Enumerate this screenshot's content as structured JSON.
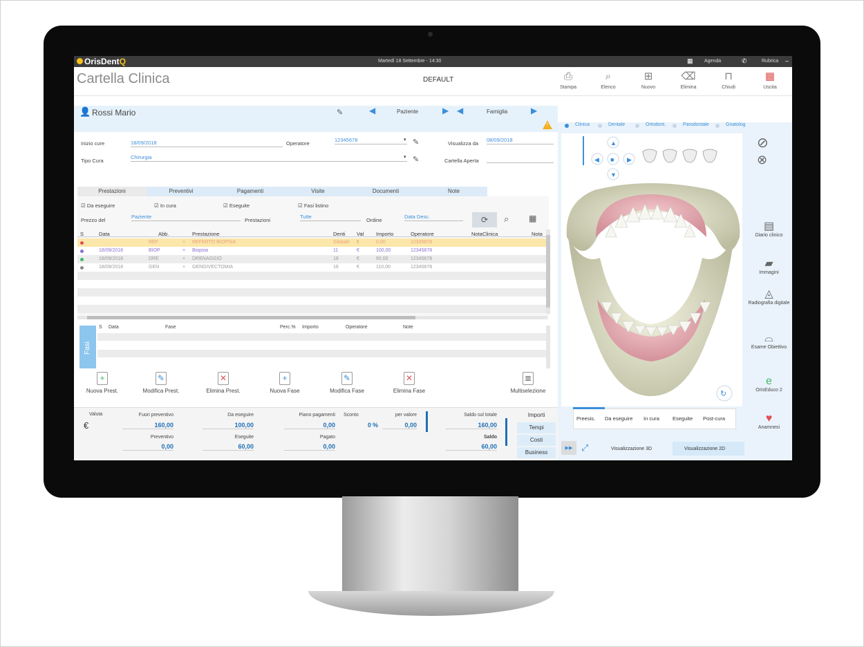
{
  "app": {
    "logo_text": "OrisDent",
    "logo_q": "Q",
    "datetime": "Martedì 18 Settembre - 14:30",
    "agenda": "Agenda",
    "rubrica": "Rubrica",
    "page_title": "Cartella Clinica",
    "profile": "DEFAULT"
  },
  "toolbar": [
    {
      "label": "Stampa",
      "icon": "printer-icon",
      "glyph": "⎙"
    },
    {
      "label": "Elenco",
      "icon": "search-icon",
      "glyph": "⌕"
    },
    {
      "label": "Nuovo",
      "icon": "new-document-icon",
      "glyph": "⊞"
    },
    {
      "label": "Elimina",
      "icon": "trash-icon",
      "glyph": "⌫"
    },
    {
      "label": "Chiudi",
      "icon": "lock-icon",
      "glyph": "⊓"
    },
    {
      "label": "Uscita",
      "icon": "exit-grid-icon",
      "glyph": "▦"
    }
  ],
  "patient": {
    "name": "Rossi Mario",
    "nav_patient": "Paziente",
    "nav_family": "Famiglia"
  },
  "form": {
    "inizio_cure_label": "Inizio cure",
    "inizio_cure": "18/09/2018",
    "operatore_label": "Operatore",
    "operatore": "12345678",
    "visualizza_label": "Visualizza da",
    "visualizza": "08/09/2018",
    "tipo_cura_label": "Tipo Cura",
    "tipo_cura": "Chirurgia",
    "cartella_label": "Cartella Aperta"
  },
  "tabs": [
    "Prestazioni",
    "Preventivi",
    "Pagamenti",
    "Visite",
    "Documenti",
    "Note"
  ],
  "filters": {
    "da_eseguire": "Da eseguire",
    "in_cura": "In cura",
    "eseguite": "Eseguite",
    "fasi_listino": "Fasi listino",
    "prezzo_label": "Prezzo del",
    "prezzo": "Paziente",
    "prestazioni_label": "Prestazioni",
    "prestazioni": "Tutte",
    "ordine_label": "Ordine",
    "ordine": "Data Desc."
  },
  "table": {
    "headers": [
      "S",
      "Data",
      "Abb.",
      "Prestazione",
      "Denti",
      "Val",
      "Importo",
      "Operatore",
      "NotaClinica",
      "Nota"
    ],
    "rows": [
      {
        "color": "#e05050",
        "data": "",
        "abb": "REF",
        "prest": "REFERTO BIOPSIA",
        "denti": "Globale",
        "val": "€",
        "imp": "0,00",
        "op": "12345678",
        "text": "#e8a080",
        "bg": "#fbe7a9"
      },
      {
        "color": "#8a6fd1",
        "data": "18/09/2018",
        "abb": "BIOP",
        "prest": "Biopsia",
        "denti": "11",
        "val": "€",
        "imp": "100,00",
        "op": "12345678",
        "text": "#8a6fd1",
        "bg": "#ffffff"
      },
      {
        "color": "#3cba6a",
        "data": "18/09/2018",
        "abb": "DRE",
        "prest": "DRENAGGIO",
        "denti": "18",
        "val": "€",
        "imp": "60,00",
        "op": "12345678",
        "text": "#999999",
        "bg": "#ececec"
      },
      {
        "color": "#888888",
        "data": "18/09/2018",
        "abb": "GEN",
        "prest": "GENGIVECTOMIA",
        "denti": "16",
        "val": "€",
        "imp": "110,00",
        "op": "12345678",
        "text": "#999999",
        "bg": "#ffffff"
      }
    ]
  },
  "fasi": {
    "tab": "Fasi",
    "headers": [
      "S",
      "Data",
      "Fase",
      "Perc.%",
      "Importo",
      "Operatore",
      "Note"
    ]
  },
  "actions": [
    {
      "label": "Nuova Prest.",
      "icon": "add-icon",
      "glyph": "+",
      "color": "#3cba6a"
    },
    {
      "label": "Modifica Prest.",
      "icon": "edit-icon",
      "glyph": "✎",
      "color": "#3b8fd9"
    },
    {
      "label": "Elimina Prest.",
      "icon": "delete-icon",
      "glyph": "✕",
      "color": "#e05050"
    },
    {
      "label": "Nuova Fase",
      "icon": "add-icon",
      "glyph": "+",
      "color": "#3b8fd9"
    },
    {
      "label": "Modifica Fase",
      "icon": "edit-icon",
      "glyph": "✎",
      "color": "#3b8fd9"
    },
    {
      "label": "Elimina Fase",
      "icon": "delete-icon",
      "glyph": "✕",
      "color": "#e05050"
    },
    {
      "label": "Multiselezione",
      "icon": "list-icon",
      "glyph": "≣",
      "color": "#666666"
    }
  ],
  "totals": {
    "valuta_label": "Valuta",
    "valuta": "€",
    "fuori_prev_label": "Fuori preventivo",
    "fuori_prev": "160,00",
    "preventivo_label": "Preventivo",
    "preventivo": "0,00",
    "da_eseguire_label": "Da eseguire",
    "da_eseguire": "100,00",
    "eseguite_label": "Eseguite",
    "eseguite": "60,00",
    "piano_label": "Piano pagamenti",
    "piano": "0,00",
    "pagato_label": "Pagato",
    "pagato": "0,00",
    "sconto_label": "Sconto",
    "sconto": "0",
    "sconto_unit": "%",
    "per_valore_label": "per valore",
    "per_valore": "0,00",
    "saldo_totale_label": "Saldo sul totale",
    "saldo_totale": "160,00",
    "saldo_label": "Saldo",
    "saldo": "60,00",
    "side_tabs": [
      "Importi",
      "Tempi",
      "Costi",
      "Business"
    ]
  },
  "view": {
    "top_tabs": [
      "Clinica",
      "Dentale",
      "Ortodont.",
      "Parodontale",
      "Gnatolog."
    ],
    "sub_tabs": [
      "Preesis.",
      "Da eseguire",
      "In cura",
      "Eseguite",
      "Post-cura"
    ],
    "view3d": "Visualizzazione 3D",
    "view2d": "Visualizzazione 2D"
  },
  "sidebar": [
    {
      "label": "Diario clinico",
      "icon": "diary-icon",
      "glyph": "▤"
    },
    {
      "label": "Immagini",
      "icon": "folder-icon",
      "glyph": "▰"
    },
    {
      "label": "Radiografia digitale",
      "icon": "xray-icon",
      "glyph": "◬"
    },
    {
      "label": "Esame Obiettivo",
      "icon": "tooth-icon",
      "glyph": "⌓"
    },
    {
      "label": "OrisEduco 2",
      "icon": "educo-icon",
      "glyph": "e"
    },
    {
      "label": "Anamnesi",
      "icon": "heart-icon",
      "glyph": "♥"
    }
  ]
}
